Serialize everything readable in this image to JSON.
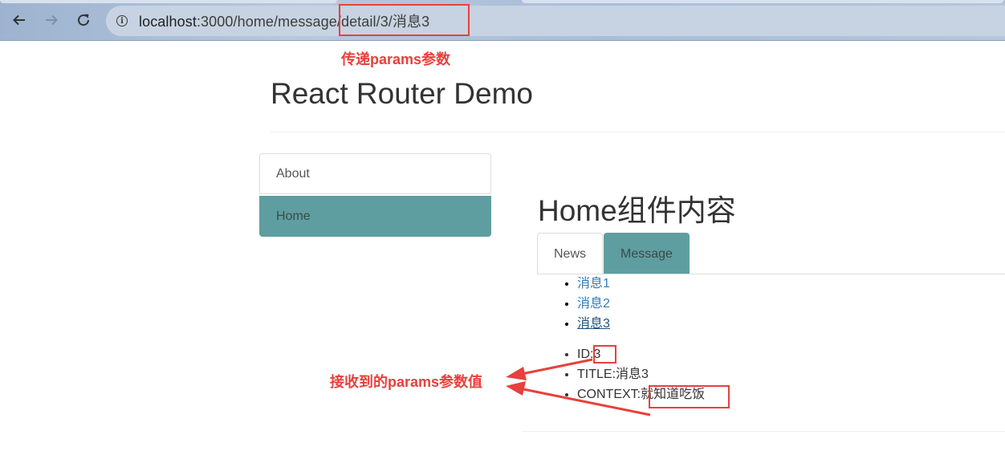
{
  "browser": {
    "back_icon": "arrow-left-icon",
    "forward_icon": "arrow-right-icon",
    "reload_icon": "reload-icon",
    "info_icon": "info-icon",
    "url_host": "localhost",
    "url_rest": ":3000/home/message/detail/3/消息3"
  },
  "annotations": {
    "url_note": "传递params参数",
    "params_note": "接收到的params参数值",
    "color": "#e8403c"
  },
  "app": {
    "title": "React Router Demo",
    "nav": [
      {
        "label": "About",
        "active": false
      },
      {
        "label": "Home",
        "active": true
      }
    ],
    "home": {
      "title": "Home组件内容",
      "tabs": [
        {
          "label": "News",
          "active": false
        },
        {
          "label": "Message",
          "active": true
        }
      ],
      "messages": [
        {
          "label": "消息1",
          "active": false
        },
        {
          "label": "消息2",
          "active": false
        },
        {
          "label": "消息3",
          "active": true
        }
      ],
      "detail": {
        "id_label": "ID:",
        "id_value": "3",
        "title_label": "TITLE:",
        "title_value": "消息3",
        "content_label": "CONTEXT:",
        "content_value": "就知道吃饭"
      }
    },
    "accent_color": "#5f9ea0",
    "link_color": "#337ab7"
  }
}
